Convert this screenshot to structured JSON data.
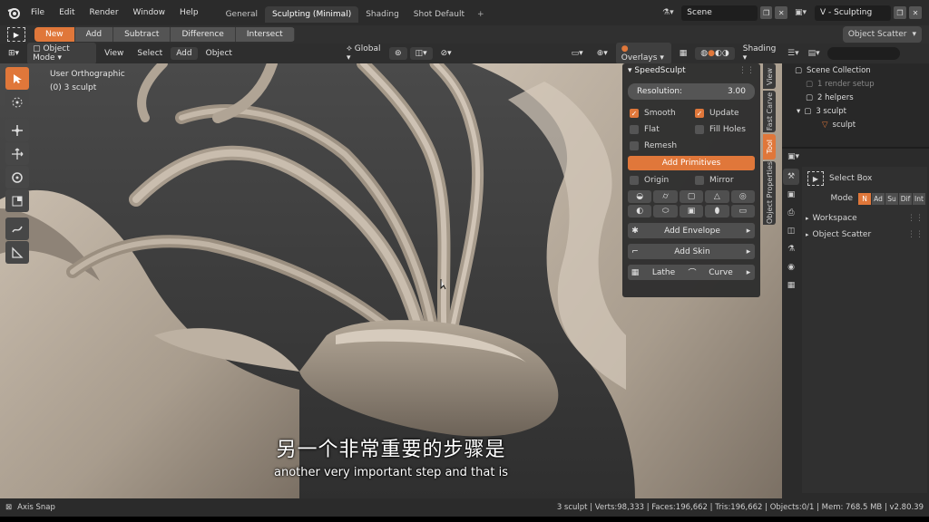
{
  "menu": [
    "File",
    "Edit",
    "Render",
    "Window",
    "Help"
  ],
  "workspaces": [
    "General",
    "Sculpting (Minimal)",
    "Shading",
    "Shot Default"
  ],
  "active_workspace": "Sculpting (Minimal)",
  "scene": "Scene",
  "view_layer": "V - Sculpting",
  "boolean_modes": [
    "New",
    "Add",
    "Subtract",
    "Difference",
    "Intersect"
  ],
  "active_boolean": "New",
  "object_scatter": "Object Scatter",
  "viewport": {
    "mode": "Object Mode",
    "menus": [
      "View",
      "Select",
      "Add",
      "Object"
    ],
    "orientation": "Global",
    "overlays": "Overlays",
    "shading": "Shading",
    "view_name": "User Orthographic",
    "object_info": "(0) 3 sculpt"
  },
  "speedsculpt": {
    "title": "SpeedSculpt",
    "resolution_label": "Resolution:",
    "resolution_value": "3.00",
    "smooth": "Smooth",
    "update": "Update",
    "flat": "Flat",
    "fill_holes": "Fill Holes",
    "remesh": "Remesh",
    "add_primitives": "Add Primitives",
    "origin": "Origin",
    "mirror": "Mirror",
    "add_envelope": "Add Envelope",
    "add_skin": "Add Skin",
    "lathe": "Lathe",
    "curve": "Curve"
  },
  "side_tabs": [
    "View",
    "Fast Carve",
    "Tool",
    "Object Properties"
  ],
  "outliner": {
    "items": [
      "Scene Collection",
      "1 render setup",
      "2 helpers",
      "3 sculpt",
      "sculpt"
    ]
  },
  "properties": {
    "select_box": "Select Box",
    "mode_label": "Mode",
    "modes": [
      "N",
      "Ad",
      "Su",
      "Dif",
      "Int"
    ],
    "workspace": "Workspace",
    "object_scatter": "Object Scatter"
  },
  "subtitles": {
    "cn": "另一个非常重要的步骤是",
    "en": "another very important step and that is"
  },
  "status": {
    "left": "Axis Snap",
    "right": "3 sculpt | Verts:98,333 | Faces:196,662 | Tris:196,662 | Objects:0/1 | Mem: 768.5 MB | v2.80.39"
  },
  "colors": {
    "accent": "#e0773a",
    "clay": "#b4a898",
    "bg": "#3a3a3a"
  }
}
